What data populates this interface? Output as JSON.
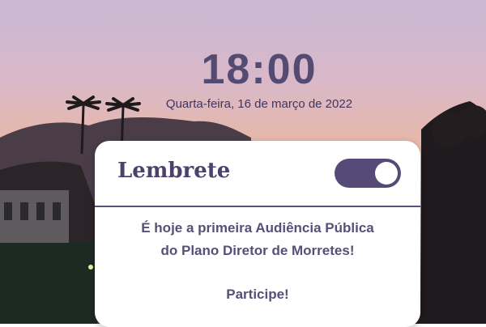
{
  "lock_screen": {
    "time": "18:00",
    "date": "Quarta-feira, 16 de março de 2022"
  },
  "notification": {
    "title": "Lembrete",
    "toggle_state": "on",
    "message_line1": "É hoje a primeira Audiência Pública",
    "message_line2": "do Plano Diretor de Morretes!",
    "call_to_action": "Participe!"
  },
  "colors": {
    "accent": "#564b78",
    "text": "#4b416a"
  }
}
